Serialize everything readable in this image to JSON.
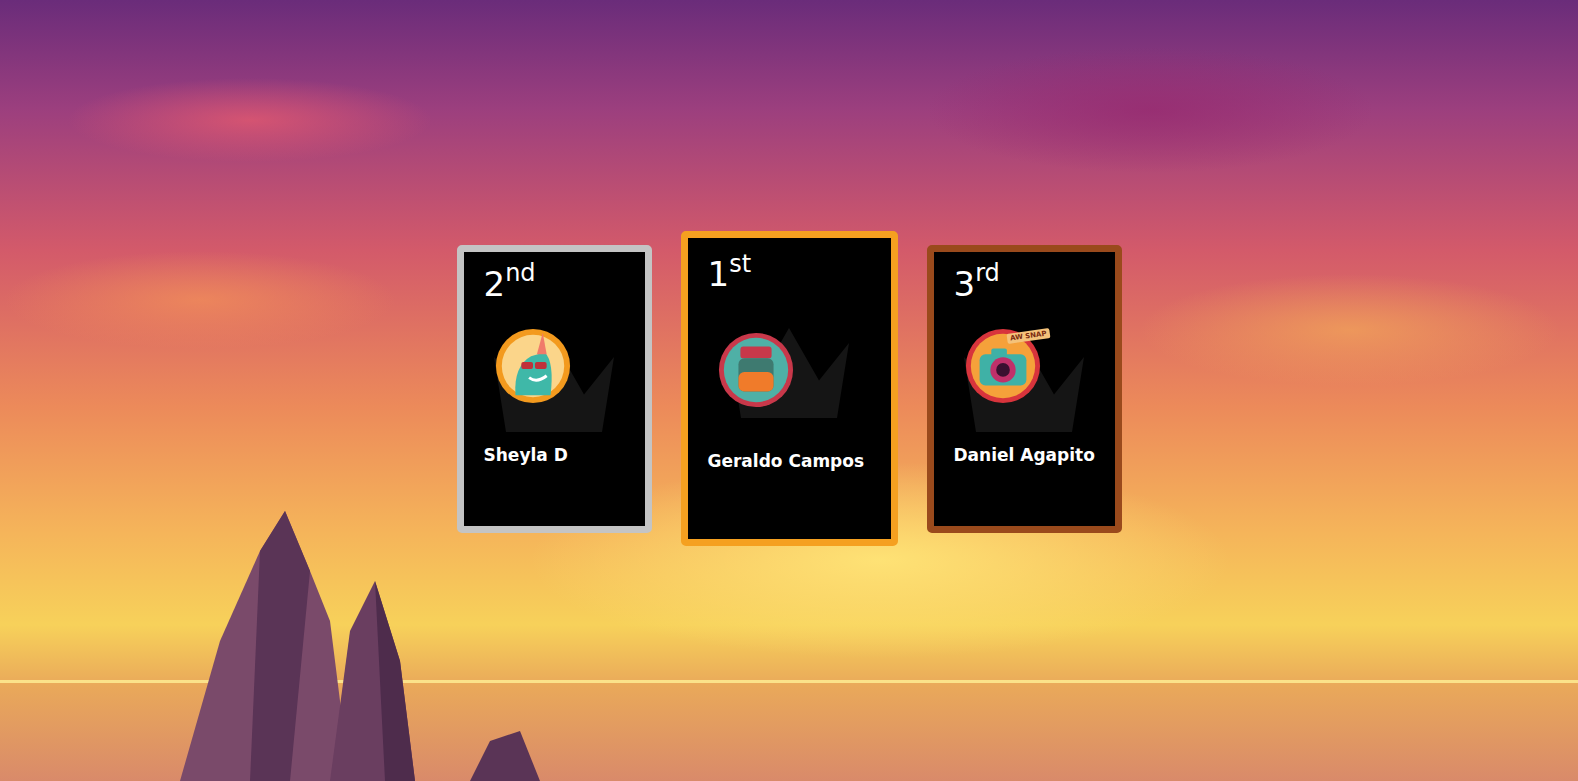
{
  "podium": [
    {
      "place": "2",
      "suffix": "nd",
      "name": "Sheyla D",
      "color": "#c4c4c4",
      "kind": "podium",
      "avatar": "unicorn"
    },
    {
      "place": "1",
      "suffix": "st",
      "name": "Geraldo Campos",
      "color": "#f5a020",
      "kind": "champion",
      "avatar": "jar"
    },
    {
      "place": "3",
      "suffix": "rd",
      "name": "Daniel Agapito",
      "color": "#9a4a1c",
      "kind": "podium",
      "avatar": "camera",
      "badge": "AW SNAP"
    }
  ]
}
